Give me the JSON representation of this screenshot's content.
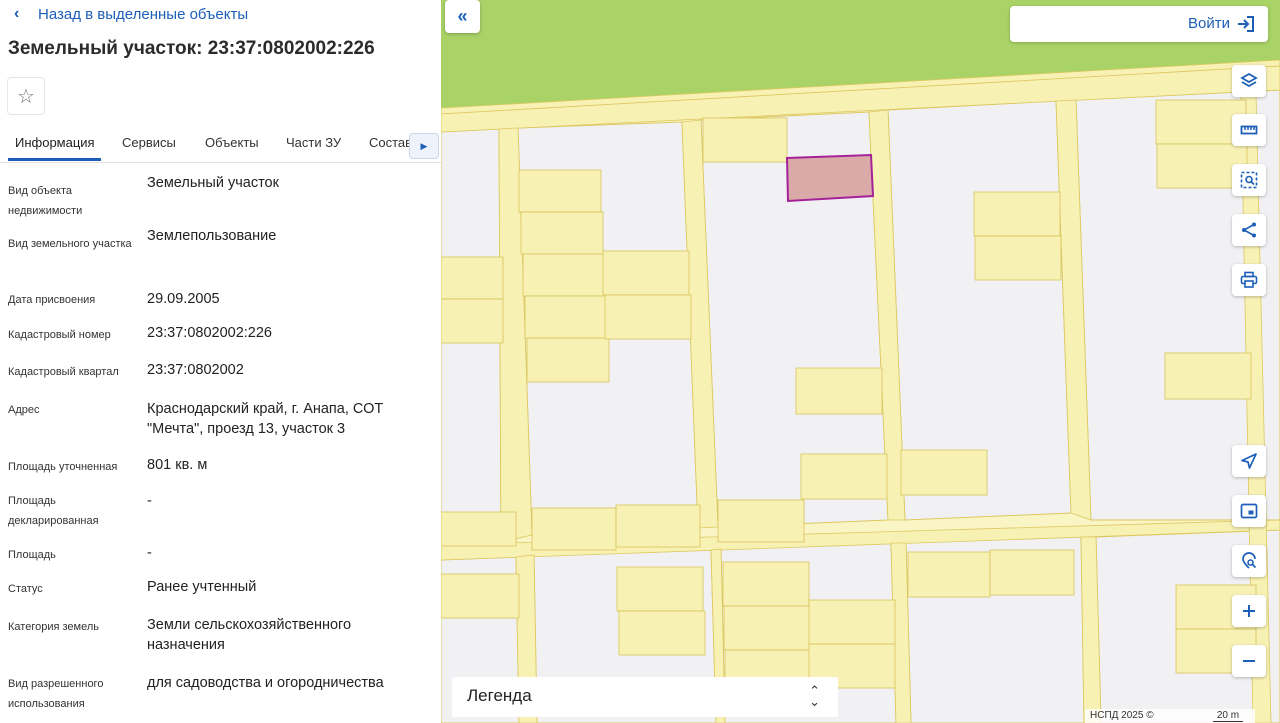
{
  "panel": {
    "back_label": "Назад в выделенные объекты",
    "title": "Земельный участок: 23:37:0802002:226",
    "tabs": [
      "Информация",
      "Сервисы",
      "Объекты",
      "Части ЗУ",
      "Состав"
    ],
    "active_tab": "Информация",
    "rows": [
      {
        "label": "Вид объекта недвижимости",
        "value": "Земельный участок"
      },
      {
        "label": "Вид земельного участка",
        "value": "Землепользование"
      },
      {
        "label": "Дата присвоения",
        "value": "29.09.2005"
      },
      {
        "label": "Кадастровый номер",
        "value": "23:37:0802002:226"
      },
      {
        "label": "Кадастровый квартал",
        "value": "23:37:0802002"
      },
      {
        "label": "Адрес",
        "value": "Краснодарский край, г. Анапа, СОТ \"Мечта\", проезд 13, участок 3"
      },
      {
        "label": "Площадь уточненная",
        "value": "801 кв. м"
      },
      {
        "label": "Площадь декларированная",
        "value": "-"
      },
      {
        "label": "Площадь",
        "value": "-"
      },
      {
        "label": "Статус",
        "value": "Ранее учтенный"
      },
      {
        "label": "Категория земель",
        "value": "Земли сельскохозяйственного назначения"
      },
      {
        "label": "Вид разрешенного использования",
        "value": "для садоводства и огородничества"
      }
    ]
  },
  "map": {
    "login_label": "Войти",
    "legend_label": "Легенда",
    "attribution": "НСПД 2025 ©",
    "scale_label": "20 m",
    "colors": {
      "parcel_fill": "#f8f1b4",
      "parcel_stroke": "#dcc860",
      "block_fill": "#f1f1f3",
      "field_green": "#a9d267",
      "selected_fill": "#d9aaa8",
      "selected_stroke": "#a5219a",
      "accent": "#1d5fb8"
    },
    "tools": [
      "layers-icon",
      "ruler-icon",
      "select-area-icon",
      "share-icon",
      "print-icon",
      "locate-icon",
      "minimap-icon",
      "geo-search-icon",
      "zoom-in-icon",
      "zoom-out-icon"
    ]
  }
}
